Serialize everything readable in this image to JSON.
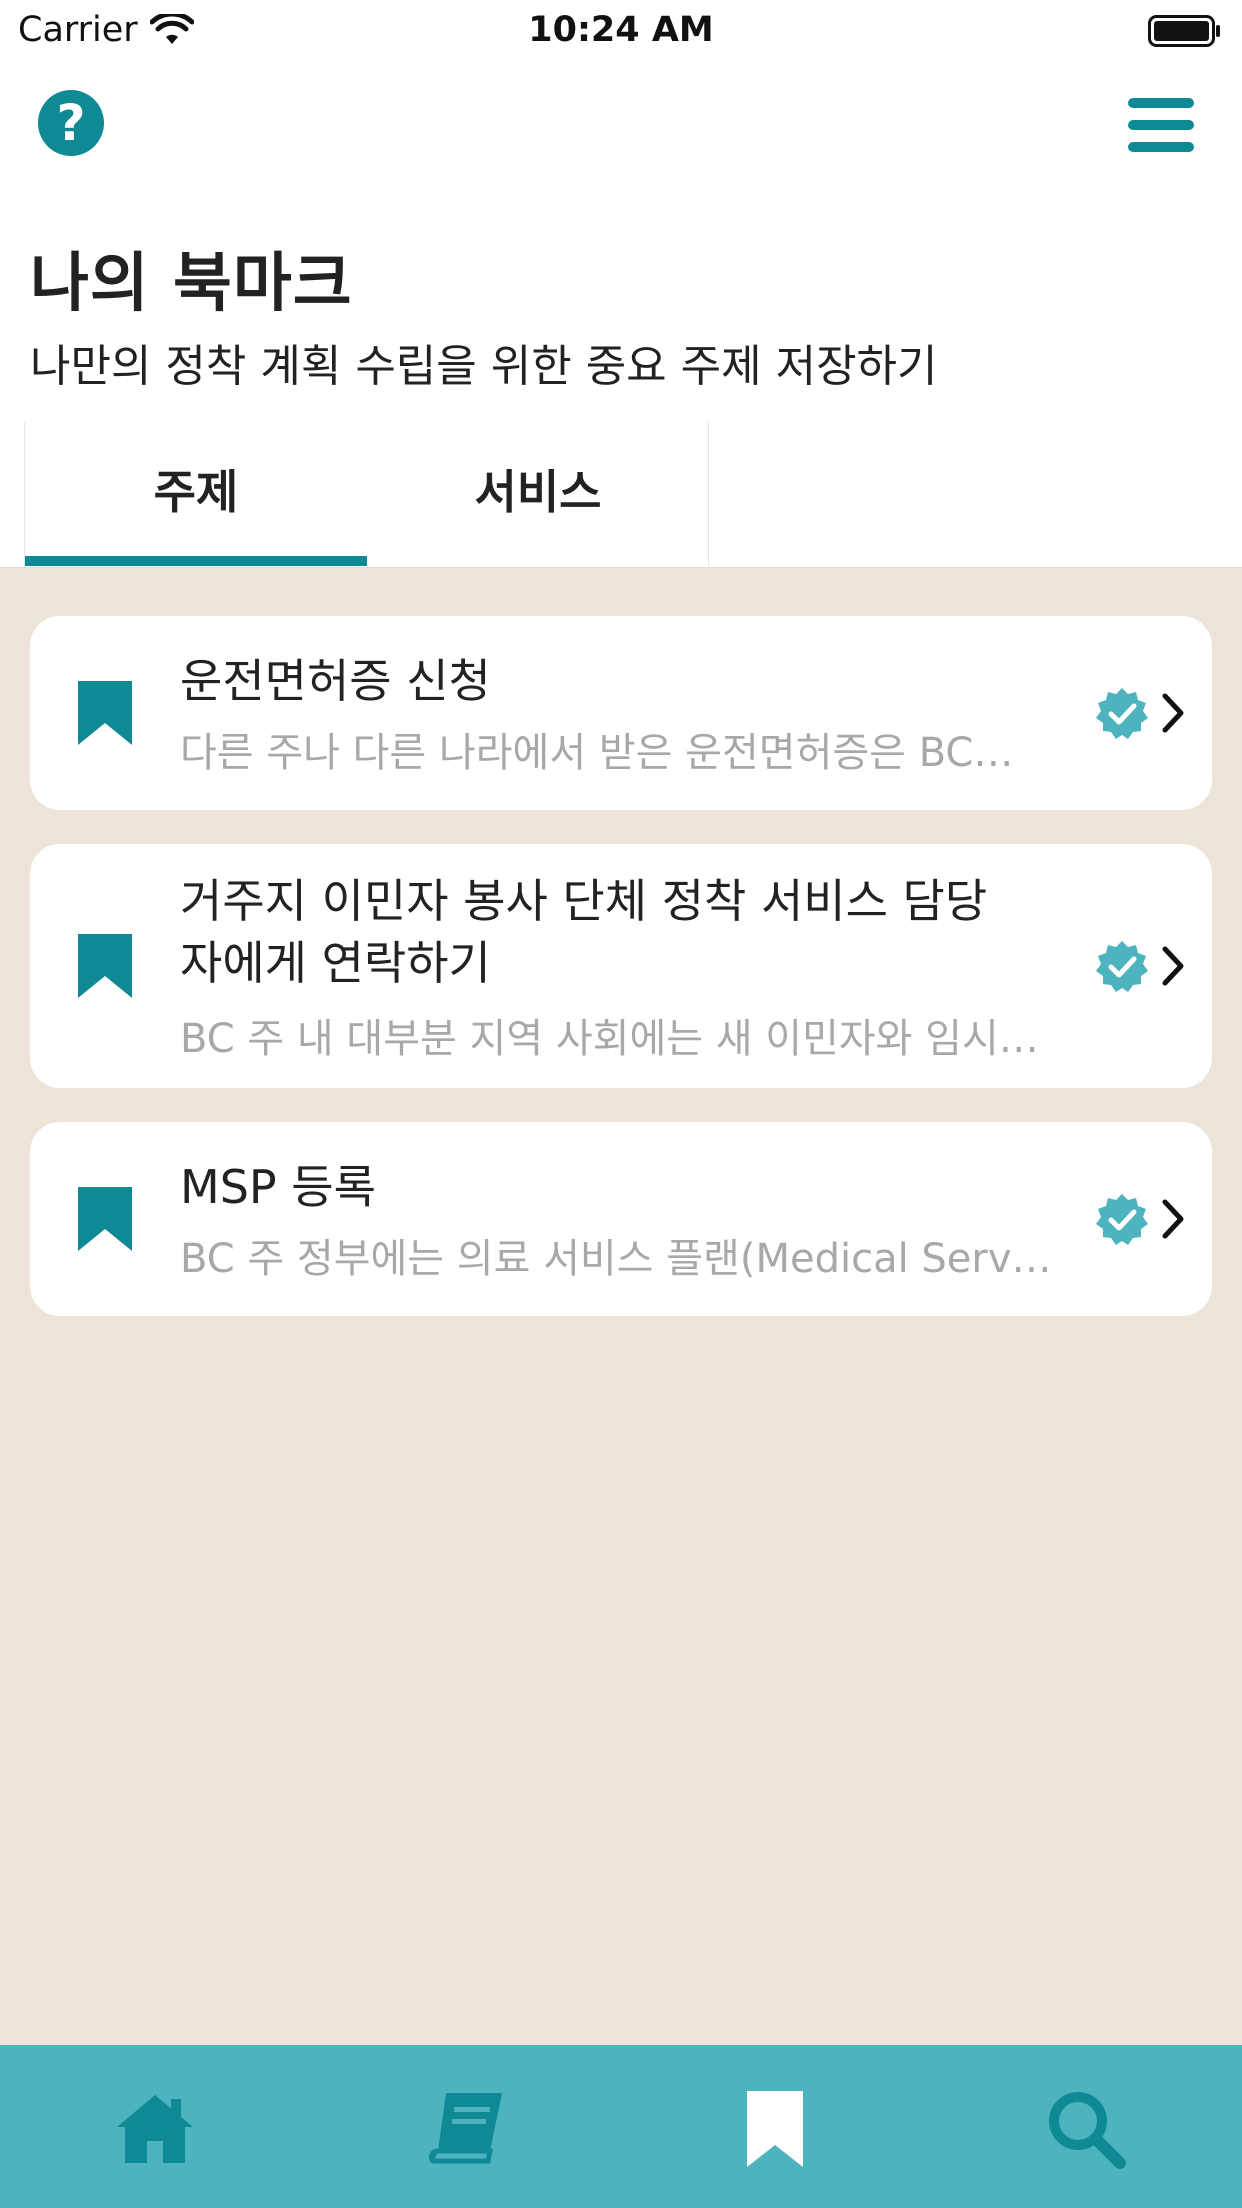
{
  "status_bar": {
    "carrier": "Carrier",
    "time": "10:24 AM"
  },
  "nav": {
    "help_icon": "question-circle-icon",
    "menu_icon": "hamburger-menu-icon"
  },
  "header": {
    "title": "나의 북마크",
    "subtitle": "나만의 정착 계획 수립을 위한 중요 주제 저장하기"
  },
  "tabs": [
    {
      "label": "주제",
      "active": true
    },
    {
      "label": "서비스",
      "active": false
    }
  ],
  "bookmarks": [
    {
      "title": "운전면허증 신청",
      "description": "다른 주나 다른 나라에서 받은 운전면허증은 BC…",
      "verified": true
    },
    {
      "title": "거주지 이민자 봉사 단체 정착 서비스 담당자에게 연락하기",
      "description": "BC 주 내 대부분 지역 사회에는 새 이민자와 임시…",
      "verified": true
    },
    {
      "title": "MSP 등록",
      "description": "BC 주 정부에는 의료 서비스 플랜(Medical Servi…",
      "verified": true
    }
  ],
  "bottom_tabs": [
    {
      "name": "home",
      "icon": "home-icon",
      "active": false
    },
    {
      "name": "guide",
      "icon": "book-icon",
      "active": false
    },
    {
      "name": "bookmarks",
      "icon": "bookmark-icon",
      "active": true
    },
    {
      "name": "search",
      "icon": "search-icon",
      "active": false
    }
  ],
  "colors": {
    "accent": "#0f8a95",
    "tabbar": "#4db3bf",
    "content_bg": "#ece4d8",
    "verified": "#4db3bf"
  }
}
